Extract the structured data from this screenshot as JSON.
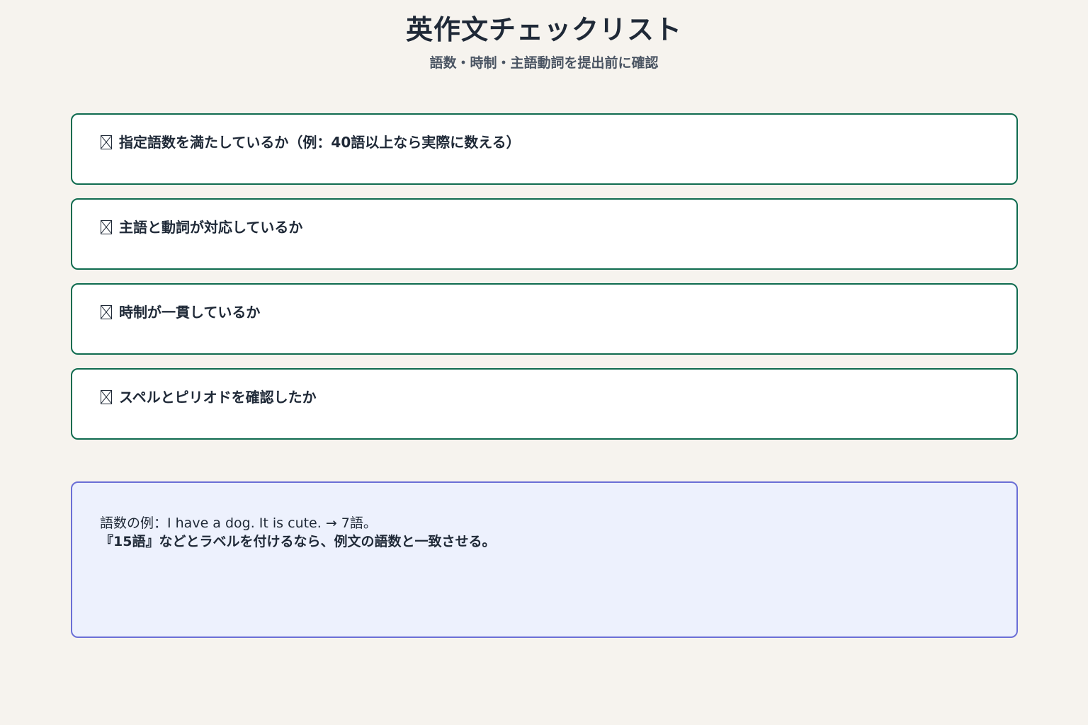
{
  "header": {
    "title": "英作文チェックリスト",
    "subtitle": "語数・時制・主語動詞を提出前に確認"
  },
  "checklist": {
    "items": [
      {
        "label": "指定語数を満たしているか（例：40語以上なら実際に数える）",
        "checked": false
      },
      {
        "label": "主語と動詞が対応しているか",
        "checked": false
      },
      {
        "label": "時制が一貫しているか",
        "checked": false
      },
      {
        "label": "スペルとピリオドを確認したか",
        "checked": false
      }
    ]
  },
  "note": {
    "line1": "語数の例：I have a dog. It is cute. → 7語。",
    "line2": "『15語』などとラベルを付けるなら、例文の語数と一致させる。"
  },
  "colors": {
    "background": "#f6f3ee",
    "item_border": "#0f6b4f",
    "note_background": "#edf1fd",
    "note_border": "#6b6fd6",
    "text": "#1f2937",
    "subtitle": "#4b5563"
  }
}
